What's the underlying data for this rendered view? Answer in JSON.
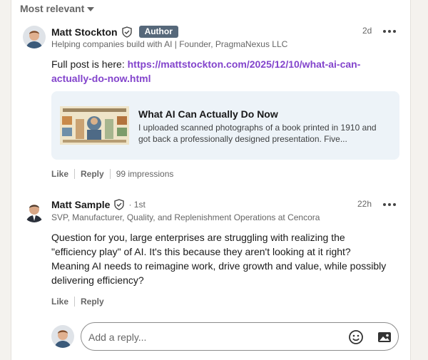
{
  "sort": {
    "label": "Most relevant"
  },
  "comments": [
    {
      "author": "Matt Stockton",
      "badge": "Author",
      "headline": "Helping companies build with AI | Founder, PragmaNexus LLC",
      "time": "2d",
      "text_prefix": "Full post is here: ",
      "link_text": "https://mattstockton.com/2025/12/10/what-ai-can-actually-do-now.html",
      "link_line1": "https://mattstockton.com/2025/12/10/what-ai-can-",
      "link_line2": "actually-do-now.html",
      "preview": {
        "title": "What AI Can Actually Do Now",
        "description": "I uploaded scanned photographs of a book printed in 1910 and got back a professionally designed presentation. Five..."
      },
      "actions": {
        "like": "Like",
        "reply": "Reply",
        "impressions": "99 impressions"
      }
    },
    {
      "author": "Matt Sample",
      "degree": "· 1st",
      "headline": "SVP, Manufacturer, Quality, and Replenishment Operations at Cencora",
      "time": "22h",
      "text": "Question for you, large enterprises are struggling with realizing the \"efficiency play\" of AI. It's this because they aren't looking at it right? Meaning AI needs to reimagine work, drive growth and value, while possibly delivering efficiency?",
      "actions": {
        "like": "Like",
        "reply": "Reply"
      }
    }
  ],
  "reply": {
    "placeholder": "Add a reply..."
  },
  "icons": {
    "sort": "caret-down-icon",
    "verified": "shield-check-icon",
    "more": "ellipsis-icon",
    "emoji": "emoji-icon",
    "image": "image-icon"
  },
  "colors": {
    "link": "#8344cc",
    "badge": "#56687a",
    "preview_bg": "#edf3f8"
  }
}
